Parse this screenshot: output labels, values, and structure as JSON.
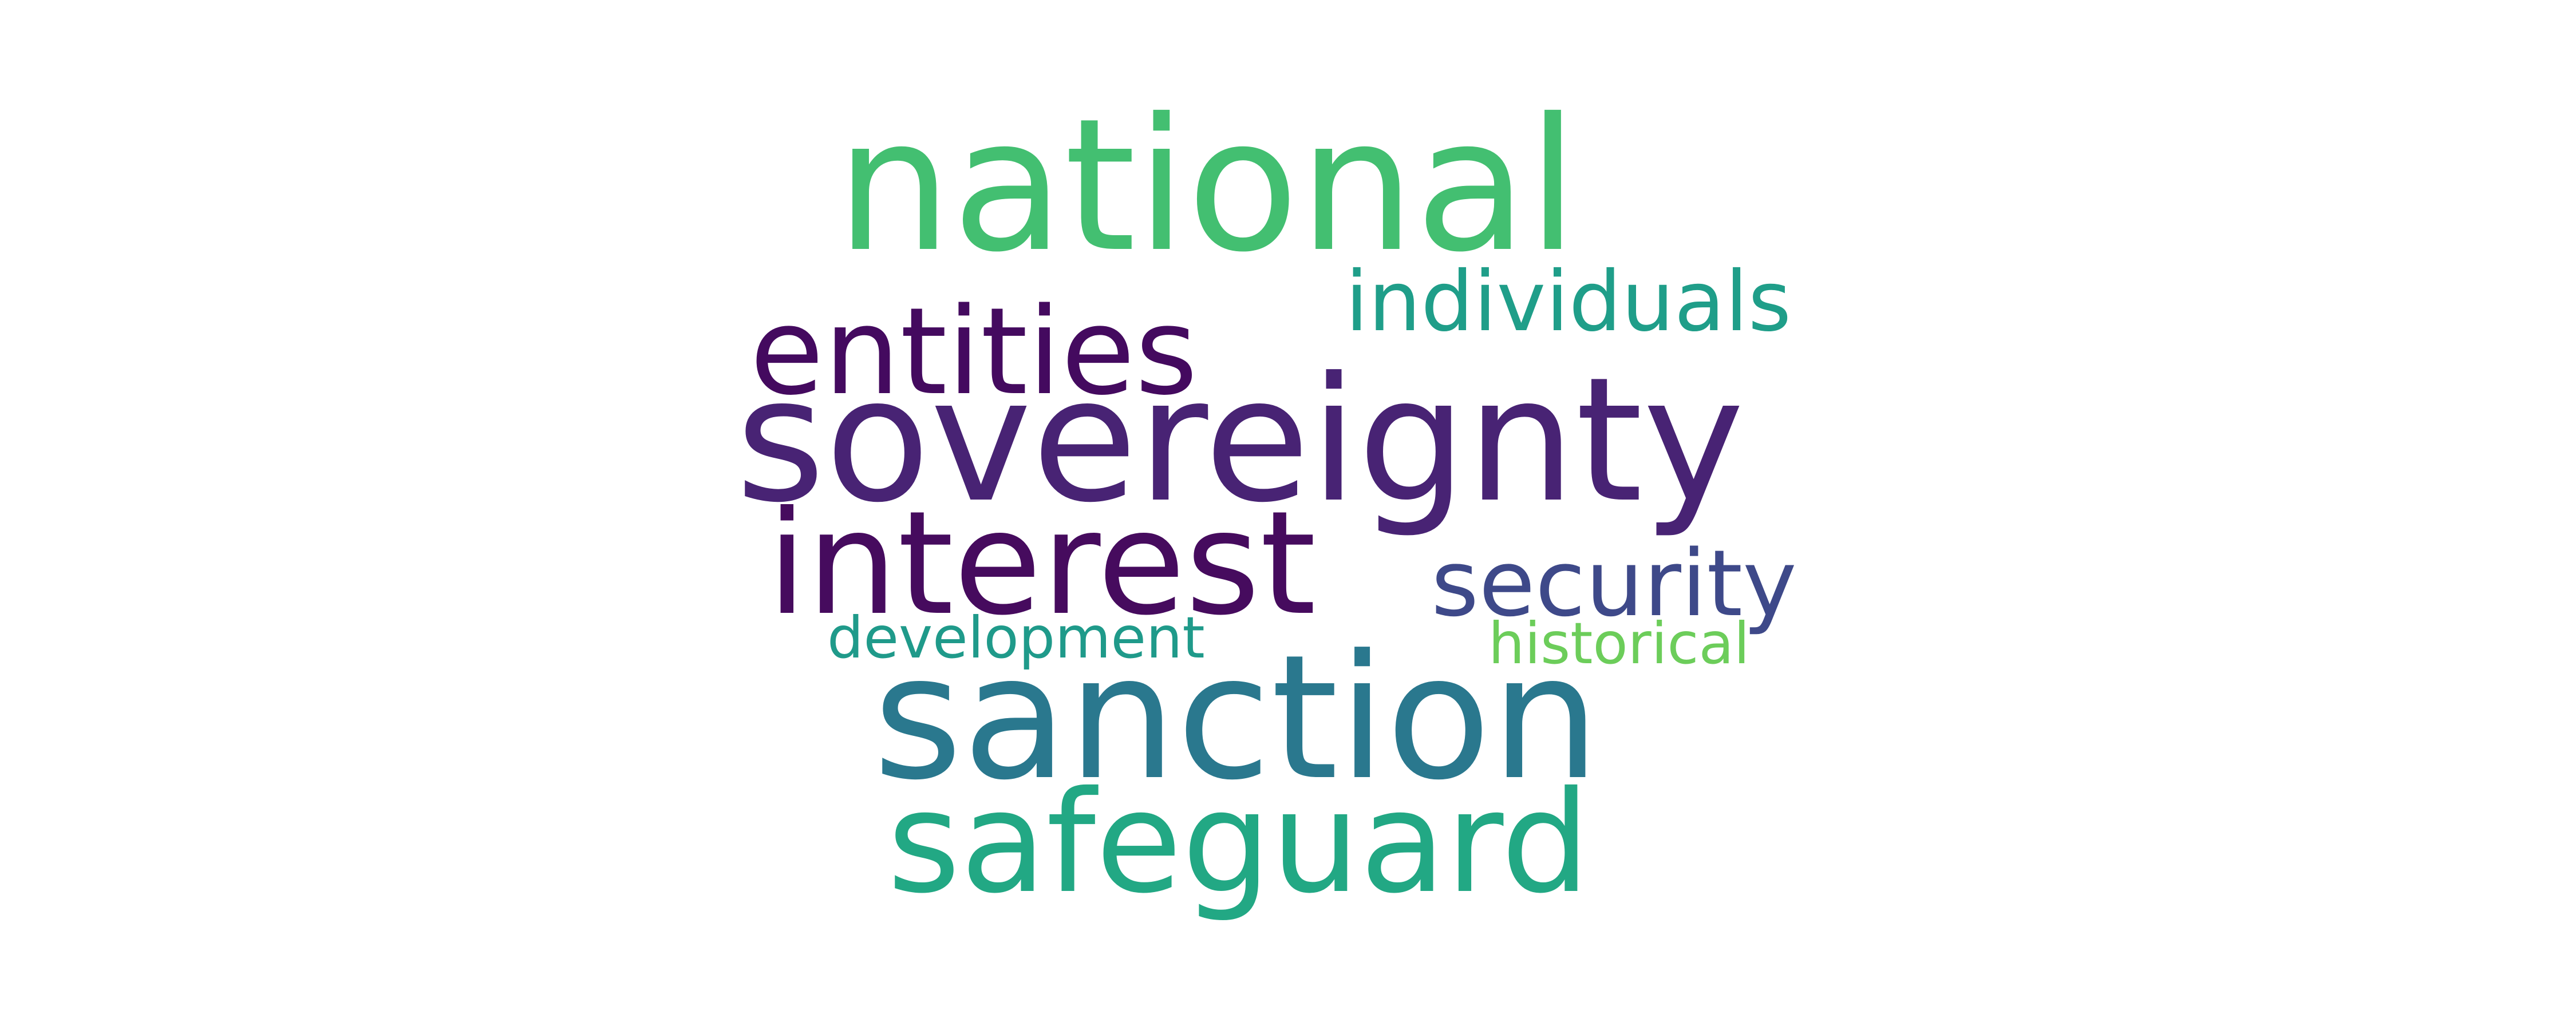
{
  "words": [
    {
      "key": "national",
      "text": "national",
      "color": "#43bf71"
    },
    {
      "key": "individuals",
      "text": "individuals",
      "color": "#1f9e89"
    },
    {
      "key": "entities",
      "text": "entities",
      "color": "#440a5f"
    },
    {
      "key": "sovereignty",
      "text": "sovereignty",
      "color": "#482374"
    },
    {
      "key": "interest",
      "text": "interest",
      "color": "#460b5e"
    },
    {
      "key": "security",
      "text": "security",
      "color": "#3e4989"
    },
    {
      "key": "development",
      "text": "development",
      "color": "#1f9a8a"
    },
    {
      "key": "historical",
      "text": "historical",
      "color": "#6ccd5a"
    },
    {
      "key": "sanction",
      "text": "sanction",
      "color": "#2a788e"
    },
    {
      "key": "safeguard",
      "text": "safeguard",
      "color": "#22a884"
    }
  ]
}
